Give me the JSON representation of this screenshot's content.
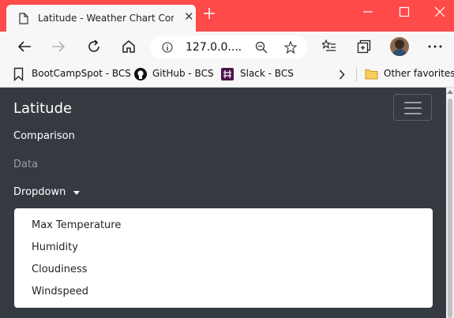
{
  "browser": {
    "tab_title": "Latitude - Weather Chart Comparison",
    "address": "127.0.0....",
    "favorites": [
      {
        "label": "BootCampSpot - BCS",
        "icon": "bookmark-icon"
      },
      {
        "label": "GitHub - BCS",
        "icon": "github-icon"
      },
      {
        "label": "Slack - BCS",
        "icon": "slack-icon"
      }
    ],
    "other_favorites": "Other favorites",
    "accent_color": "#ff4a4a"
  },
  "page": {
    "brand": "Latitude",
    "nav": [
      {
        "label": "Comparison",
        "state": "active"
      },
      {
        "label": "Data",
        "state": "muted"
      }
    ],
    "dropdown_label": "Dropdown",
    "dropdown_items": [
      "Max Temperature",
      "Humidity",
      "Cloudiness",
      "Windspeed"
    ],
    "navbar_color": "#343a40"
  }
}
